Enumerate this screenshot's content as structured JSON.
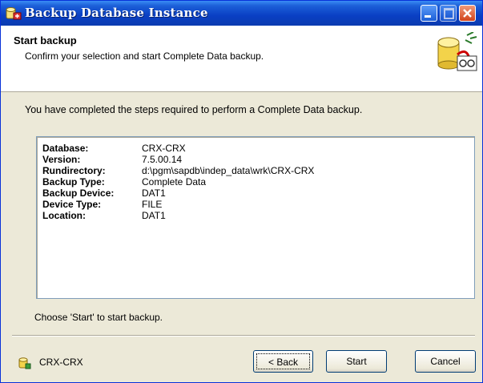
{
  "window": {
    "title": "Backup Database Instance",
    "colors": {
      "titlebar": "#0a3fc4",
      "frame": "#ece9d8",
      "close": "#d2441c"
    }
  },
  "header": {
    "title": "Start backup",
    "subtitle": "Confirm your selection and start Complete Data backup."
  },
  "main": {
    "intro": "You have completed the steps required to perform a Complete Data backup.",
    "summary": [
      {
        "key": "Database:",
        "value": "CRX-CRX"
      },
      {
        "key": "Version:",
        "value": "7.5.00.14"
      },
      {
        "key": "Rundirectory:",
        "value": "d:\\pgm\\sapdb\\indep_data\\wrk\\CRX-CRX"
      },
      {
        "key": "Backup Type:",
        "value": "Complete Data"
      },
      {
        "key": "Backup Device:",
        "value": "DAT1"
      },
      {
        "key": "Device Type:",
        "value": "FILE"
      },
      {
        "key": "Location:",
        "value": "DAT1"
      }
    ],
    "hint": "Choose 'Start' to start backup."
  },
  "footer": {
    "instance": "CRX-CRX",
    "back_label": "< Back",
    "start_label": "Start",
    "cancel_label": "Cancel"
  },
  "icons": {
    "title": "database-backup-icon",
    "header": "database-tape-icon",
    "status": "database-instance-icon"
  }
}
